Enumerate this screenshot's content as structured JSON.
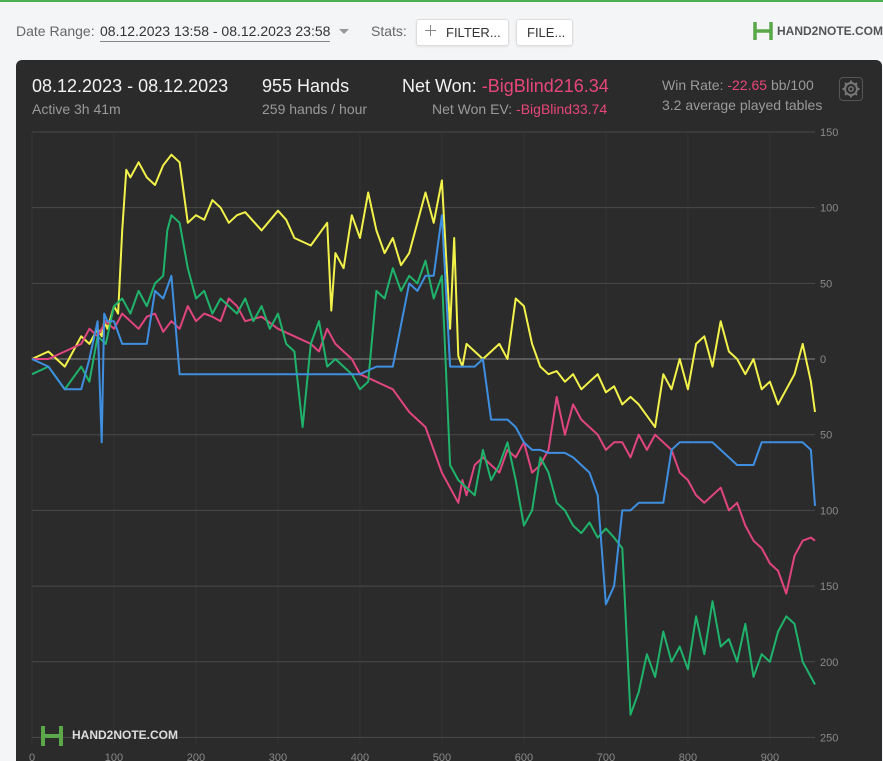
{
  "toolbar": {
    "date_range_label": "Date Range:",
    "date_range_value": "08.12.2023 13:58 - 08.12.2023 23:58",
    "stats_label": "Stats:",
    "filter_button": "FILTER...",
    "file_button": "FILE...",
    "brand": "HAND2NOTE.COM"
  },
  "summary": {
    "date": "08.12.2023 - 08.12.2023",
    "active": "Active 3h 41m",
    "hands": "955 Hands",
    "hands_per_hour": "259 hands / hour",
    "net_won_label": "Net Won:",
    "net_won_value": "-BigBlind216.34",
    "net_won_ev_label": "Net Won  EV:",
    "net_won_ev_value": "-BigBlind33.74",
    "win_rate_label": "Win Rate:",
    "win_rate_value": "-22.65",
    "win_rate_unit": "bb/100",
    "avg_tables": "3.2 average played tables"
  },
  "watermark": "HAND2NOTE.COM",
  "colors": {
    "background": "#2b2b2b",
    "negative": "#e8467a",
    "yellow": "#f2f24a",
    "pink": "#e0457f",
    "green": "#1fb36b",
    "blue": "#3f8fe0"
  },
  "chart_data": {
    "type": "line",
    "title": "",
    "xlabel": "",
    "ylabel": "",
    "x_ticks": [
      0,
      100,
      200,
      300,
      400,
      500,
      600,
      700,
      800,
      900
    ],
    "y_ticks": [
      150,
      100,
      50,
      0,
      -50,
      -100,
      -150,
      -200,
      -250
    ],
    "y_tick_labels": [
      "150",
      "100",
      "50",
      "0",
      "50",
      "100",
      "150",
      "200",
      "250"
    ],
    "xlim": [
      0,
      955
    ],
    "ylim": [
      -255,
      150
    ],
    "grid": true,
    "series": [
      {
        "color": "#f2f24a",
        "x": [
          0,
          20,
          40,
          60,
          70,
          80,
          85,
          88,
          92,
          100,
          105,
          110,
          115,
          120,
          130,
          140,
          150,
          160,
          170,
          180,
          190,
          200,
          210,
          220,
          230,
          240,
          250,
          260,
          280,
          300,
          310,
          320,
          340,
          360,
          365,
          370,
          380,
          390,
          400,
          410,
          420,
          430,
          440,
          450,
          460,
          480,
          490,
          500,
          510,
          515,
          520,
          525,
          530,
          550,
          560,
          570,
          580,
          590,
          600,
          610,
          620,
          630,
          640,
          650,
          660,
          670,
          680,
          690,
          700,
          710,
          720,
          730,
          740,
          760,
          770,
          780,
          790,
          800,
          810,
          820,
          830,
          840,
          850,
          860,
          870,
          880,
          890,
          900,
          910,
          920,
          930,
          940,
          950,
          955
        ],
        "values": [
          0,
          5,
          -5,
          15,
          10,
          20,
          15,
          25,
          20,
          35,
          30,
          85,
          125,
          120,
          130,
          120,
          115,
          128,
          135,
          130,
          90,
          95,
          92,
          105,
          100,
          90,
          95,
          97,
          85,
          98,
          92,
          80,
          75,
          90,
          32,
          70,
          60,
          95,
          80,
          110,
          85,
          70,
          80,
          62,
          70,
          110,
          90,
          118,
          20,
          80,
          2,
          -5,
          10,
          0,
          5,
          10,
          0,
          40,
          35,
          10,
          -5,
          -10,
          -8,
          -15,
          -10,
          -20,
          -15,
          -10,
          -22,
          -18,
          -30,
          -25,
          -30,
          -45,
          -10,
          -20,
          0,
          -20,
          10,
          15,
          -5,
          25,
          5,
          0,
          -10,
          0,
          -20,
          -15,
          -30,
          -20,
          -10,
          10,
          -15,
          -35
        ]
      },
      {
        "color": "#e0457f",
        "x": [
          0,
          20,
          40,
          60,
          70,
          80,
          90,
          100,
          110,
          120,
          130,
          140,
          150,
          160,
          170,
          180,
          190,
          200,
          210,
          220,
          230,
          240,
          250,
          260,
          280,
          300,
          320,
          340,
          350,
          360,
          370,
          380,
          390,
          400,
          420,
          440,
          460,
          480,
          500,
          510,
          520,
          525,
          530,
          540,
          550,
          560,
          570,
          580,
          590,
          600,
          610,
          620,
          630,
          640,
          650,
          660,
          670,
          680,
          690,
          700,
          710,
          720,
          730,
          740,
          750,
          760,
          770,
          780,
          790,
          800,
          810,
          820,
          830,
          840,
          850,
          860,
          870,
          880,
          890,
          900,
          910,
          920,
          930,
          940,
          950,
          955
        ],
        "values": [
          0,
          0,
          5,
          10,
          20,
          15,
          25,
          20,
          30,
          25,
          20,
          28,
          30,
          18,
          25,
          20,
          35,
          25,
          30,
          28,
          25,
          40,
          35,
          25,
          28,
          20,
          15,
          10,
          5,
          20,
          10,
          5,
          0,
          -10,
          -15,
          -20,
          -35,
          -45,
          -75,
          -85,
          -95,
          -80,
          -90,
          -70,
          -65,
          -70,
          -75,
          -60,
          -65,
          -55,
          -75,
          -70,
          -60,
          -25,
          -50,
          -30,
          -40,
          -45,
          -50,
          -60,
          -55,
          -55,
          -65,
          -50,
          -60,
          -50,
          -55,
          -60,
          -75,
          -80,
          -90,
          -95,
          -90,
          -85,
          -100,
          -95,
          -110,
          -120,
          -125,
          -135,
          -140,
          -155,
          -130,
          -120,
          -118,
          -120
        ]
      },
      {
        "color": "#1fb36b",
        "x": [
          0,
          20,
          40,
          60,
          70,
          80,
          90,
          100,
          110,
          120,
          130,
          140,
          150,
          160,
          165,
          170,
          180,
          190,
          200,
          210,
          220,
          230,
          240,
          250,
          260,
          270,
          280,
          290,
          300,
          310,
          320,
          330,
          340,
          350,
          360,
          370,
          380,
          390,
          400,
          410,
          420,
          430,
          440,
          450,
          460,
          470,
          480,
          490,
          500,
          510,
          520,
          530,
          540,
          550,
          560,
          570,
          580,
          590,
          600,
          610,
          620,
          630,
          640,
          650,
          660,
          670,
          680,
          690,
          700,
          710,
          720,
          730,
          740,
          750,
          760,
          770,
          780,
          790,
          800,
          810,
          820,
          830,
          840,
          850,
          860,
          870,
          880,
          890,
          900,
          910,
          920,
          930,
          940,
          950,
          955
        ],
        "values": [
          -10,
          -5,
          -20,
          -5,
          -15,
          15,
          10,
          35,
          40,
          30,
          45,
          35,
          50,
          55,
          85,
          95,
          90,
          60,
          40,
          45,
          30,
          40,
          35,
          30,
          40,
          25,
          35,
          20,
          30,
          10,
          5,
          -45,
          10,
          25,
          -5,
          0,
          -5,
          -10,
          -20,
          -15,
          45,
          40,
          60,
          45,
          55,
          50,
          65,
          40,
          55,
          -70,
          -80,
          -85,
          -90,
          -60,
          -80,
          -70,
          -55,
          -80,
          -110,
          -100,
          -65,
          -75,
          -95,
          -100,
          -110,
          -115,
          -108,
          -118,
          -112,
          -118,
          -125,
          -235,
          -220,
          -195,
          -210,
          -180,
          -200,
          -190,
          -205,
          -170,
          -195,
          -160,
          -190,
          -185,
          -200,
          -175,
          -210,
          -195,
          -200,
          -180,
          -170,
          -175,
          -200,
          -210,
          -215
        ]
      },
      {
        "color": "#3f8fe0",
        "x": [
          0,
          20,
          40,
          60,
          70,
          80,
          85,
          88,
          92,
          100,
          110,
          120,
          130,
          140,
          150,
          160,
          170,
          180,
          190,
          200,
          220,
          240,
          260,
          280,
          300,
          320,
          340,
          360,
          380,
          400,
          420,
          440,
          460,
          470,
          480,
          490,
          500,
          510,
          520,
          525,
          530,
          540,
          550,
          560,
          570,
          580,
          590,
          600,
          610,
          620,
          630,
          640,
          650,
          660,
          670,
          680,
          690,
          700,
          710,
          720,
          730,
          740,
          750,
          760,
          770,
          780,
          790,
          800,
          810,
          820,
          830,
          840,
          850,
          860,
          870,
          880,
          890,
          900,
          910,
          920,
          930,
          940,
          950,
          955
        ],
        "values": [
          0,
          -5,
          -20,
          -20,
          0,
          25,
          -55,
          30,
          25,
          25,
          10,
          10,
          10,
          10,
          45,
          40,
          55,
          -10,
          -10,
          -10,
          -10,
          -10,
          -10,
          -10,
          -10,
          -10,
          -10,
          -10,
          -10,
          -10,
          -5,
          -5,
          50,
          45,
          55,
          55,
          95,
          -5,
          -5,
          -5,
          -5,
          -5,
          0,
          -40,
          -40,
          -40,
          -45,
          -55,
          -60,
          -60,
          -62,
          -62,
          -62,
          -65,
          -70,
          -75,
          -90,
          -162,
          -150,
          -100,
          -100,
          -95,
          -95,
          -95,
          -95,
          -60,
          -55,
          -55,
          -55,
          -55,
          -55,
          -60,
          -65,
          -70,
          -70,
          -70,
          -55,
          -55,
          -55,
          -55,
          -55,
          -55,
          -60,
          -97
        ]
      }
    ]
  }
}
